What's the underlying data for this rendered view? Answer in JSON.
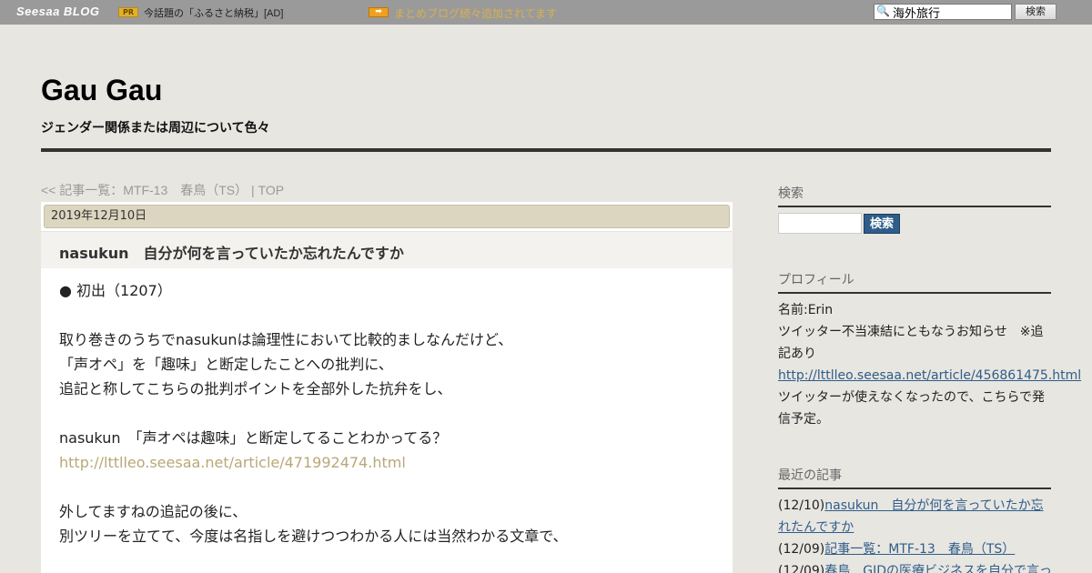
{
  "topbar": {
    "logo": "Seesaa BLOG",
    "pr_badge": "PR",
    "pr_text": "今話題の「ふるさと納税」[AD]",
    "arrow_text": "まとめブログ続々追加されてます",
    "search_value": "海外旅行",
    "search_button": "検索"
  },
  "header": {
    "title": "Gau Gau",
    "description": "ジェンダー関係または周辺について色々"
  },
  "breadcrumb": {
    "prev": "<< 記事一覧：MTF-13　春鳥（TS）",
    "separator": " | ",
    "top": "TOP"
  },
  "article": {
    "date": "2019年12月10日",
    "title": "nasukun　自分が何を言っていたか忘れたんですか",
    "lines": [
      "● 初出（1207）",
      "",
      "取り巻きのうちでnasukunは論理性において比較的ましなんだけど、",
      "「声オペ」を「趣味」と断定したことへの批判に、",
      "追記と称してこちらの批判ポイントを全部外した抗弁をし、",
      "",
      "nasukun　「声オペは趣味」と断定してることわかってる？",
      "http://lttlleo.seesaa.net/article/471992474.html",
      "",
      "外してますねの追記の後に、",
      "別ツリーを立てて、今度は名指しを避けつつわかる人には当然わかる文章で、"
    ]
  },
  "sidebar": {
    "search_heading": "検索",
    "search_button": "検索",
    "profile_heading": "プロフィール",
    "profile_name": "名前:Erin",
    "profile_notice": "ツイッター不当凍結にともなうお知らせ　※追記あり",
    "profile_link": "http://lttlleo.seesaa.net/article/456861475.html",
    "profile_note": "ツイッターが使えなくなったので、こちらで発信予定。",
    "recent_heading": "最近の記事",
    "recent": [
      {
        "date": "(12/10)",
        "title": "nasukun　自分が何を言っていたか忘れたんですか"
      },
      {
        "date": "(12/09)",
        "title": "記事一覧：MTF-13　春鳥（TS）"
      },
      {
        "date": "(12/09)",
        "title": "春鳥　GIDの医療ビジネスを自分で言っ"
      }
    ]
  }
}
